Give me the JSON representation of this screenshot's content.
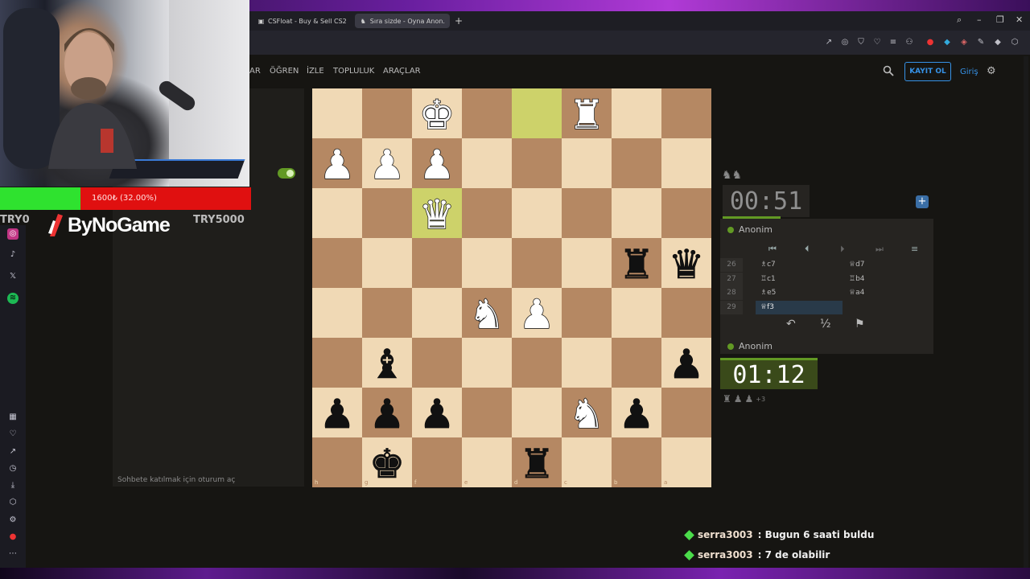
{
  "browser": {
    "tabs": [
      {
        "label": "CSFloat - Buy & Sell CS2",
        "active": false
      },
      {
        "label": "Sıra sizde - Oyna Anon.",
        "active": true
      }
    ]
  },
  "site": {
    "nav": [
      {
        "label": "AR"
      },
      {
        "label": "ÖĞREN"
      },
      {
        "label": "İZLE"
      },
      {
        "label": "TOPLULUK"
      },
      {
        "label": "ARAÇLAR"
      }
    ],
    "signup_label": "KAYIT OL",
    "login_label": "Giriş"
  },
  "stream": {
    "donation_text": "1600₺ (32.00%)",
    "donation_progress": 0.32,
    "min_label": "TRY0",
    "max_label": "TRY5000",
    "brand": "ByNoGame"
  },
  "chat": {
    "hint": "Sohbete katılmak için oturum aç"
  },
  "game": {
    "top_player": {
      "name": "Anonim",
      "clock": "00:51"
    },
    "bottom_player": {
      "name": "Anonim",
      "clock": "01:12"
    },
    "captured_extra": "+3",
    "moves": [
      {
        "num": "26",
        "white": "♗c7",
        "black": "♕d7"
      },
      {
        "num": "27",
        "white": "♖c1",
        "black": "♖b4"
      },
      {
        "num": "28",
        "white": "♗e5",
        "black": "♕a4"
      },
      {
        "num": "29",
        "white": "♕f3",
        "black": ""
      }
    ],
    "draw_symbol": "½",
    "files_bottom": [
      "h",
      "g",
      "f",
      "e",
      "d",
      "c",
      "b",
      "a"
    ],
    "ranks_right": [
      "1",
      "2",
      "3",
      "4",
      "5",
      "6",
      "7",
      "8"
    ]
  },
  "alerts": [
    {
      "user": "serra3003",
      "text": ": Bugun 6 saati buldu"
    },
    {
      "user": "serra3003",
      "text": ": 7 de olabilir"
    }
  ],
  "colors": {
    "accent_blue": "#3692e7",
    "online_green": "#629924",
    "donation_red": "#e01010",
    "donation_green": "#2fe22f"
  }
}
